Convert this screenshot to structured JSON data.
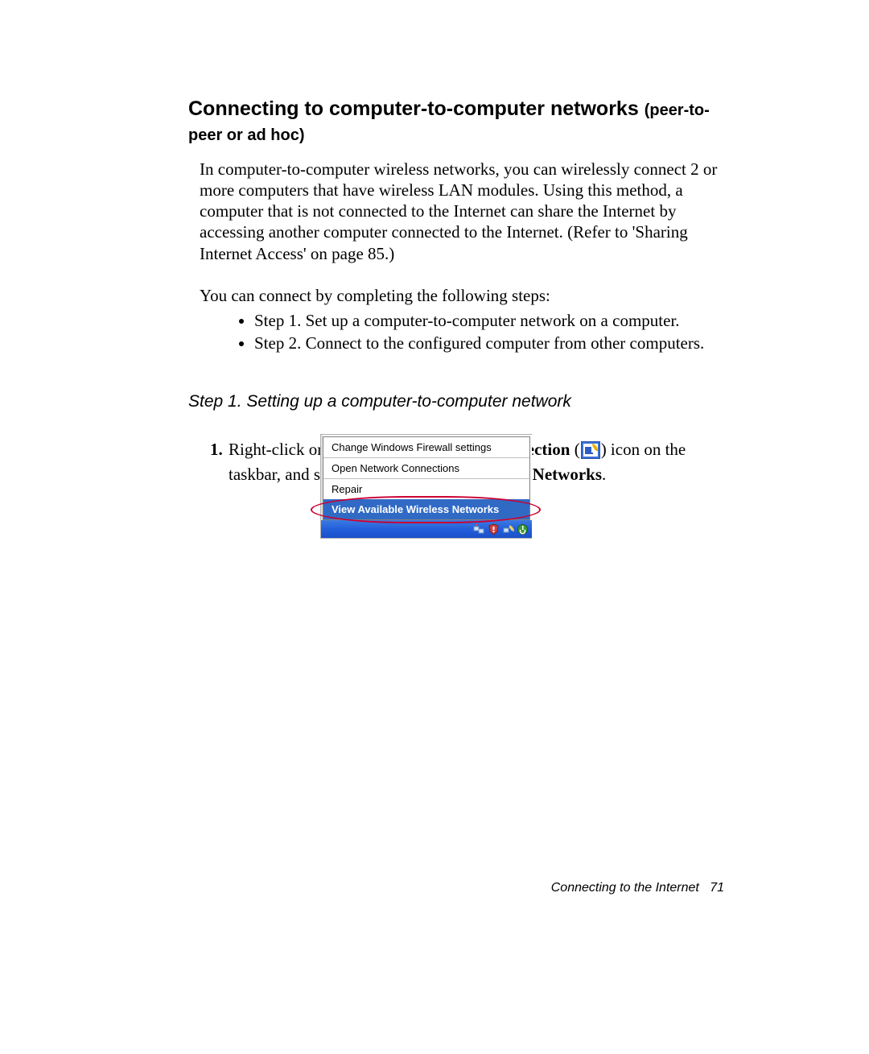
{
  "heading": {
    "main": "Connecting to computer-to-computer networks ",
    "sub": "(peer-to-peer or ad hoc)"
  },
  "intro_paragraph": "In computer-to-computer wireless networks, you can wirelessly connect 2 or more computers that have wireless LAN modules. Using this method, a computer that is not connected to the Internet can share the Internet by accessing another computer connected to the Internet. (Refer to  'Sharing Internet Access' on page 85.)",
  "steps_lead": "You can connect by completing the following steps:",
  "overview_steps": [
    "Step 1. Set up a computer-to-computer network on a computer.",
    "Step 2. Connect to the configured computer from other computers."
  ],
  "step1_title": "Step 1. Setting up a computer-to-computer network",
  "instr1": {
    "t1": "Right-click on the ",
    "b1": "Wireless Network Connection",
    "t2": " (",
    "t3": ") icon on the taskbar, and select ",
    "b2": "View Available Wireless Networks",
    "t4": "."
  },
  "context_menu": {
    "item1": "Change Windows Firewall settings",
    "item2": "Open Network Connections",
    "item3": "Repair",
    "item4": "View Available Wireless Networks"
  },
  "footer": {
    "section": "Connecting to the Internet",
    "page": "71"
  }
}
